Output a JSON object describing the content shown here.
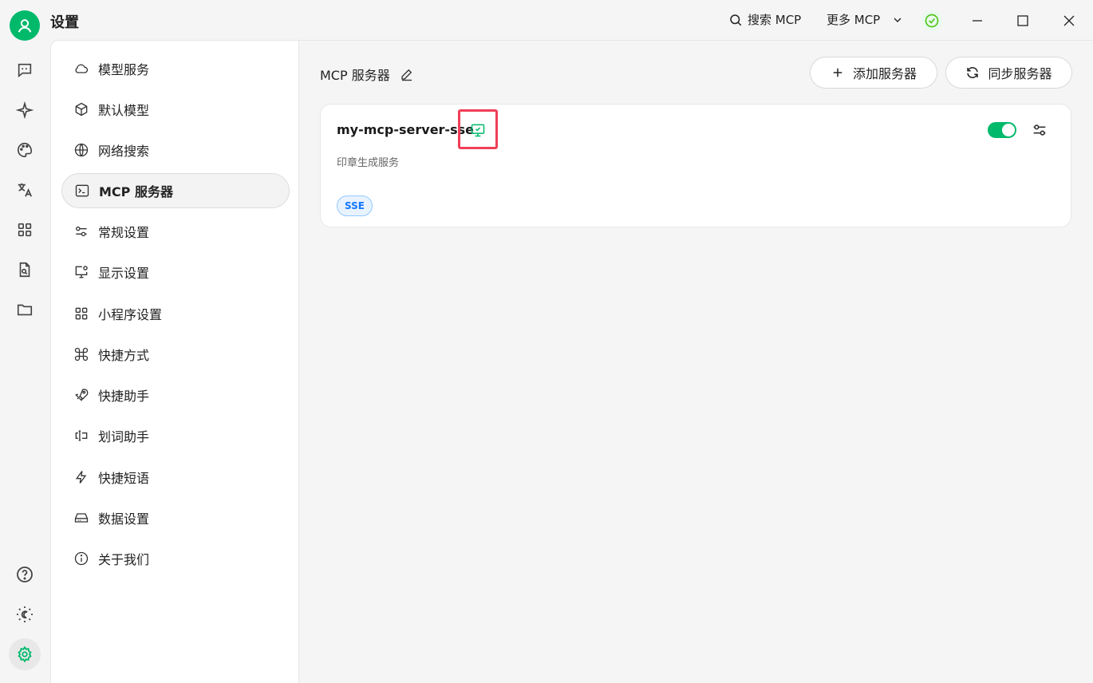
{
  "app": {
    "title": "设置"
  },
  "titlebar": {
    "search_label": "搜索 MCP",
    "more_label": "更多 MCP"
  },
  "nav": {
    "items": [
      {
        "label": "模型服务",
        "icon": "cloud-icon"
      },
      {
        "label": "默认模型",
        "icon": "cube-icon"
      },
      {
        "label": "网络搜索",
        "icon": "globe-icon"
      },
      {
        "label": "MCP 服务器",
        "icon": "terminal-icon",
        "active": true
      },
      {
        "label": "常规设置",
        "icon": "sliders-icon"
      },
      {
        "label": "显示设置",
        "icon": "monitor-settings-icon"
      },
      {
        "label": "小程序设置",
        "icon": "grid-icon"
      },
      {
        "label": "快捷方式",
        "icon": "command-icon"
      },
      {
        "label": "快捷助手",
        "icon": "rocket-icon"
      },
      {
        "label": "划词助手",
        "icon": "text-select-icon"
      },
      {
        "label": "快捷短语",
        "icon": "zap-icon"
      },
      {
        "label": "数据设置",
        "icon": "hard-drive-icon"
      },
      {
        "label": "关于我们",
        "icon": "info-icon"
      }
    ]
  },
  "main": {
    "title": "MCP 服务器",
    "add_button": "添加服务器",
    "sync_button": "同步服务器",
    "server": {
      "name": "my-mcp-server-sse",
      "description": "印章生成服务",
      "type_badge": "SSE",
      "enabled": true
    }
  },
  "colors": {
    "accent": "#00b96b",
    "badge_blue": "#1677ff",
    "highlight": "#f03e57"
  }
}
